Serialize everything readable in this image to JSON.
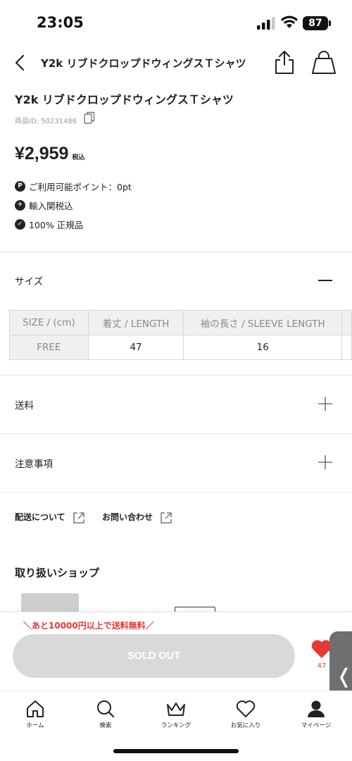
{
  "status_bar": {
    "time": "23:05",
    "battery": "87"
  },
  "header": {
    "title": "Y2k リブドクロップドウィングスＴシャツ",
    "icons": [
      "back-icon",
      "share-icon",
      "shopping-bag-icon"
    ]
  },
  "product": {
    "title": "Y2k リブドクロップドウィングスＴシャツ",
    "id_label": "商品ID: 50231486",
    "price": "¥2,959",
    "tax_label": "税込",
    "info": [
      {
        "icon": "P",
        "text": "ご利用可能ポイント：0pt"
      },
      {
        "icon": "✈",
        "text": "輸入関税込"
      },
      {
        "icon": "✓",
        "text": "100% 正規品"
      }
    ]
  },
  "size_section": {
    "label": "サイズ",
    "table": {
      "headers": [
        "SIZE / (cm)",
        "着丈 / LENGTH",
        "袖の長さ / SLEEVE LENGTH"
      ],
      "rows": [
        [
          "FREE",
          "47",
          "16"
        ]
      ]
    }
  },
  "shipping_section": {
    "label": "送料"
  },
  "notes_section": {
    "label": "注意事項"
  },
  "links": {
    "delivery": "配送について",
    "contact": "お問い合わせ"
  },
  "shop": {
    "title": "取り扱いショップ"
  },
  "purchase": {
    "shipping_note": "＼あと10000円以上で送料無料／",
    "button_label": "SOLD OUT",
    "favorite_count": "47",
    "side_tab_glyph": "❬"
  },
  "tabbar": {
    "items": [
      {
        "label": "ホーム",
        "icon": "home-icon"
      },
      {
        "label": "検索",
        "icon": "search-icon"
      },
      {
        "label": "ランキング",
        "icon": "crown-icon"
      },
      {
        "label": "お気に入り",
        "icon": "heart-icon"
      },
      {
        "label": "マイページ",
        "icon": "user-icon"
      }
    ]
  },
  "colors": {
    "accent_red": "#e53935",
    "soldout_gray": "#d9d9d9",
    "text": "#222222"
  }
}
